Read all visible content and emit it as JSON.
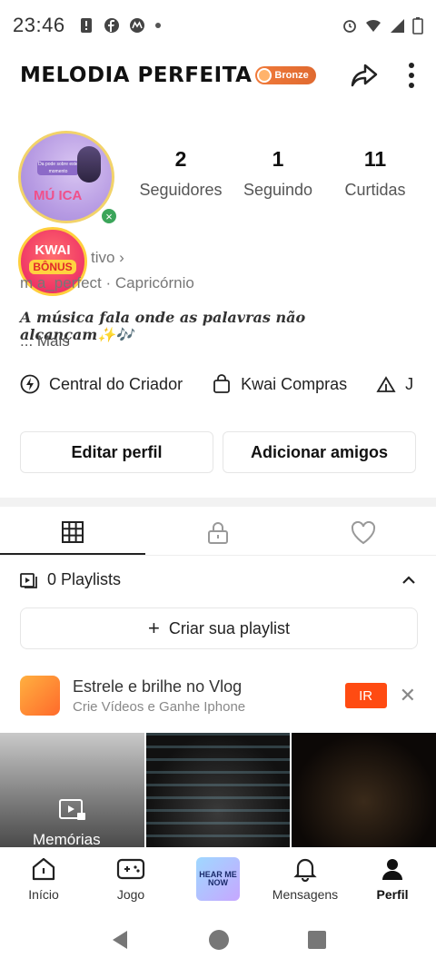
{
  "status_bar": {
    "time": "23:46"
  },
  "header": {
    "title": "MELODIA PERFEITA",
    "badge": "Bronze"
  },
  "avatar": {
    "small_text": "Da pode sobre este momento",
    "label": "MÚ ICA"
  },
  "bonus": {
    "line1": "KWAI",
    "line2": "BÔNUS"
  },
  "stats": [
    {
      "value": "2",
      "label": "Seguidores"
    },
    {
      "value": "1",
      "label": "Seguindo"
    },
    {
      "value": "11",
      "label": "Curtidas"
    }
  ],
  "profile": {
    "row1": "tivo ›",
    "handle": "m      a_perfect",
    "sign": "Capricórnio",
    "bio": "A música fala onde as palavras não alcançam✨🎶",
    "more": "...  Mais"
  },
  "shortcuts": [
    {
      "label": "Central do Criador",
      "icon": "lightning-icon"
    },
    {
      "label": "Kwai Compras",
      "icon": "shopping-bag-icon"
    },
    {
      "label": "J",
      "icon": "tent-icon"
    }
  ],
  "buttons": {
    "edit": "Editar perfil",
    "add": "Adicionar amigos"
  },
  "playlists": {
    "label": "0 Playlists",
    "create": "Criar sua playlist"
  },
  "promo": {
    "title": "Estrele e brilhe no Vlog",
    "subtitle": "Crie Vídeos e Ganhe Iphone",
    "cta": "IR"
  },
  "grid": {
    "first_label": "Memórias"
  },
  "bottom_nav": [
    {
      "label": "Início",
      "icon": "home-icon"
    },
    {
      "label": "Jogo",
      "icon": "gamepad-icon"
    },
    {
      "label": "HEAR ME NOW",
      "icon": "music-cover-icon"
    },
    {
      "label": "Mensagens",
      "icon": "bell-icon"
    },
    {
      "label": "Perfil",
      "icon": "person-icon"
    }
  ],
  "colors": {
    "accent": "#ff4b12",
    "bronze": "#e06a30"
  }
}
